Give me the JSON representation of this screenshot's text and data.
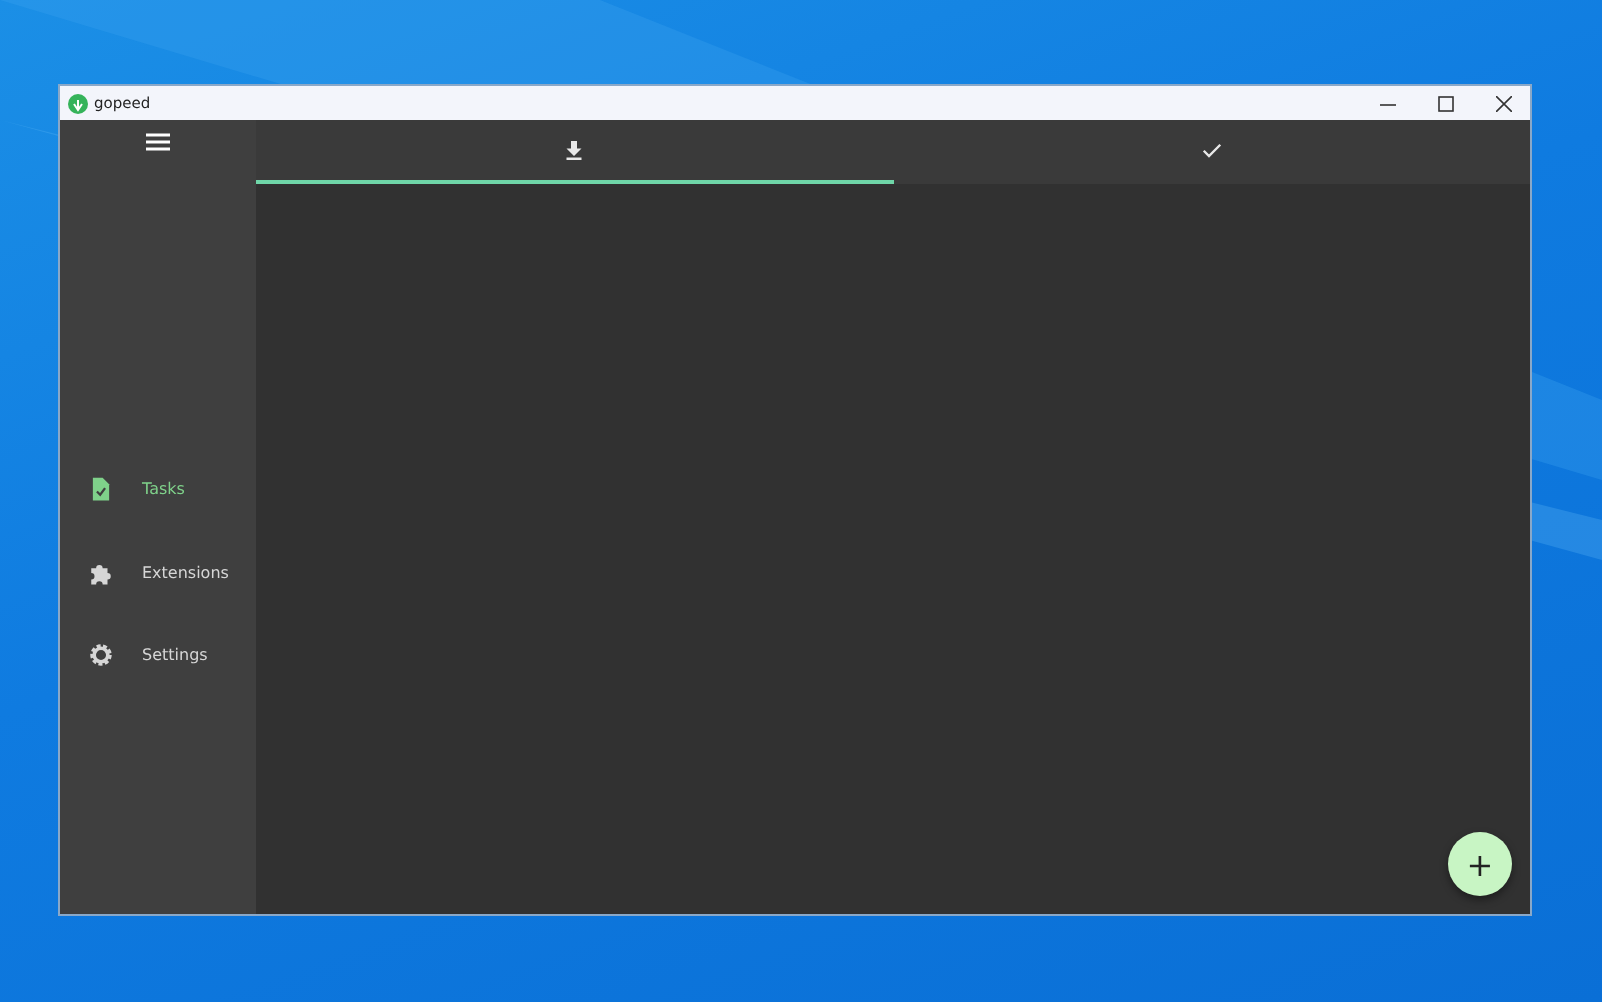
{
  "window": {
    "title": "gopeed"
  },
  "sidebar": {
    "items": [
      {
        "label": "Tasks",
        "kind": "task",
        "selected": true
      },
      {
        "label": "Extensions",
        "kind": "puzzle",
        "selected": false
      },
      {
        "label": "Settings",
        "kind": "gear",
        "selected": false
      }
    ]
  },
  "tabs": [
    {
      "kind": "download",
      "selected": true
    },
    {
      "kind": "check",
      "selected": false
    }
  ],
  "fab": {
    "label": "+"
  }
}
